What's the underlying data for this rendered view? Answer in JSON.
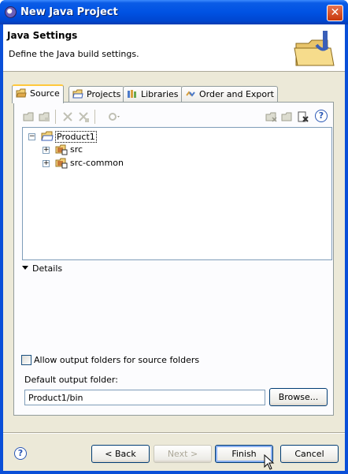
{
  "window": {
    "title": "New Java Project",
    "close_glyph": "✕"
  },
  "header": {
    "title": "Java Settings",
    "description": "Define the Java build settings.",
    "icon": "java-folder-icon"
  },
  "tabs": [
    {
      "label": "Source",
      "icon": "source-folder-icon",
      "active": true
    },
    {
      "label": "Projects",
      "icon": "projects-folder-icon",
      "active": false
    },
    {
      "label": "Libraries",
      "icon": "libraries-icon",
      "active": false
    },
    {
      "label": "Order and Export",
      "icon": "order-icon",
      "active": false
    }
  ],
  "toolbar": {
    "help_glyph": "?"
  },
  "tree": {
    "items": [
      {
        "label": "Product1",
        "expanded": true,
        "glyph": "−"
      },
      {
        "label": "src",
        "expanded": false,
        "glyph": "+"
      },
      {
        "label": "src-common",
        "expanded": false,
        "glyph": "+"
      }
    ]
  },
  "details": {
    "label": "Details"
  },
  "allow_output": {
    "label": "Allow output folders for source folders",
    "checked": false
  },
  "output": {
    "label": "Default output folder:",
    "value": "Product1/bin",
    "browse_label": "Browse..."
  },
  "buttons": {
    "help_glyph": "?",
    "back": "< Back",
    "next": "Next >",
    "finish": "Finish",
    "cancel": "Cancel"
  }
}
